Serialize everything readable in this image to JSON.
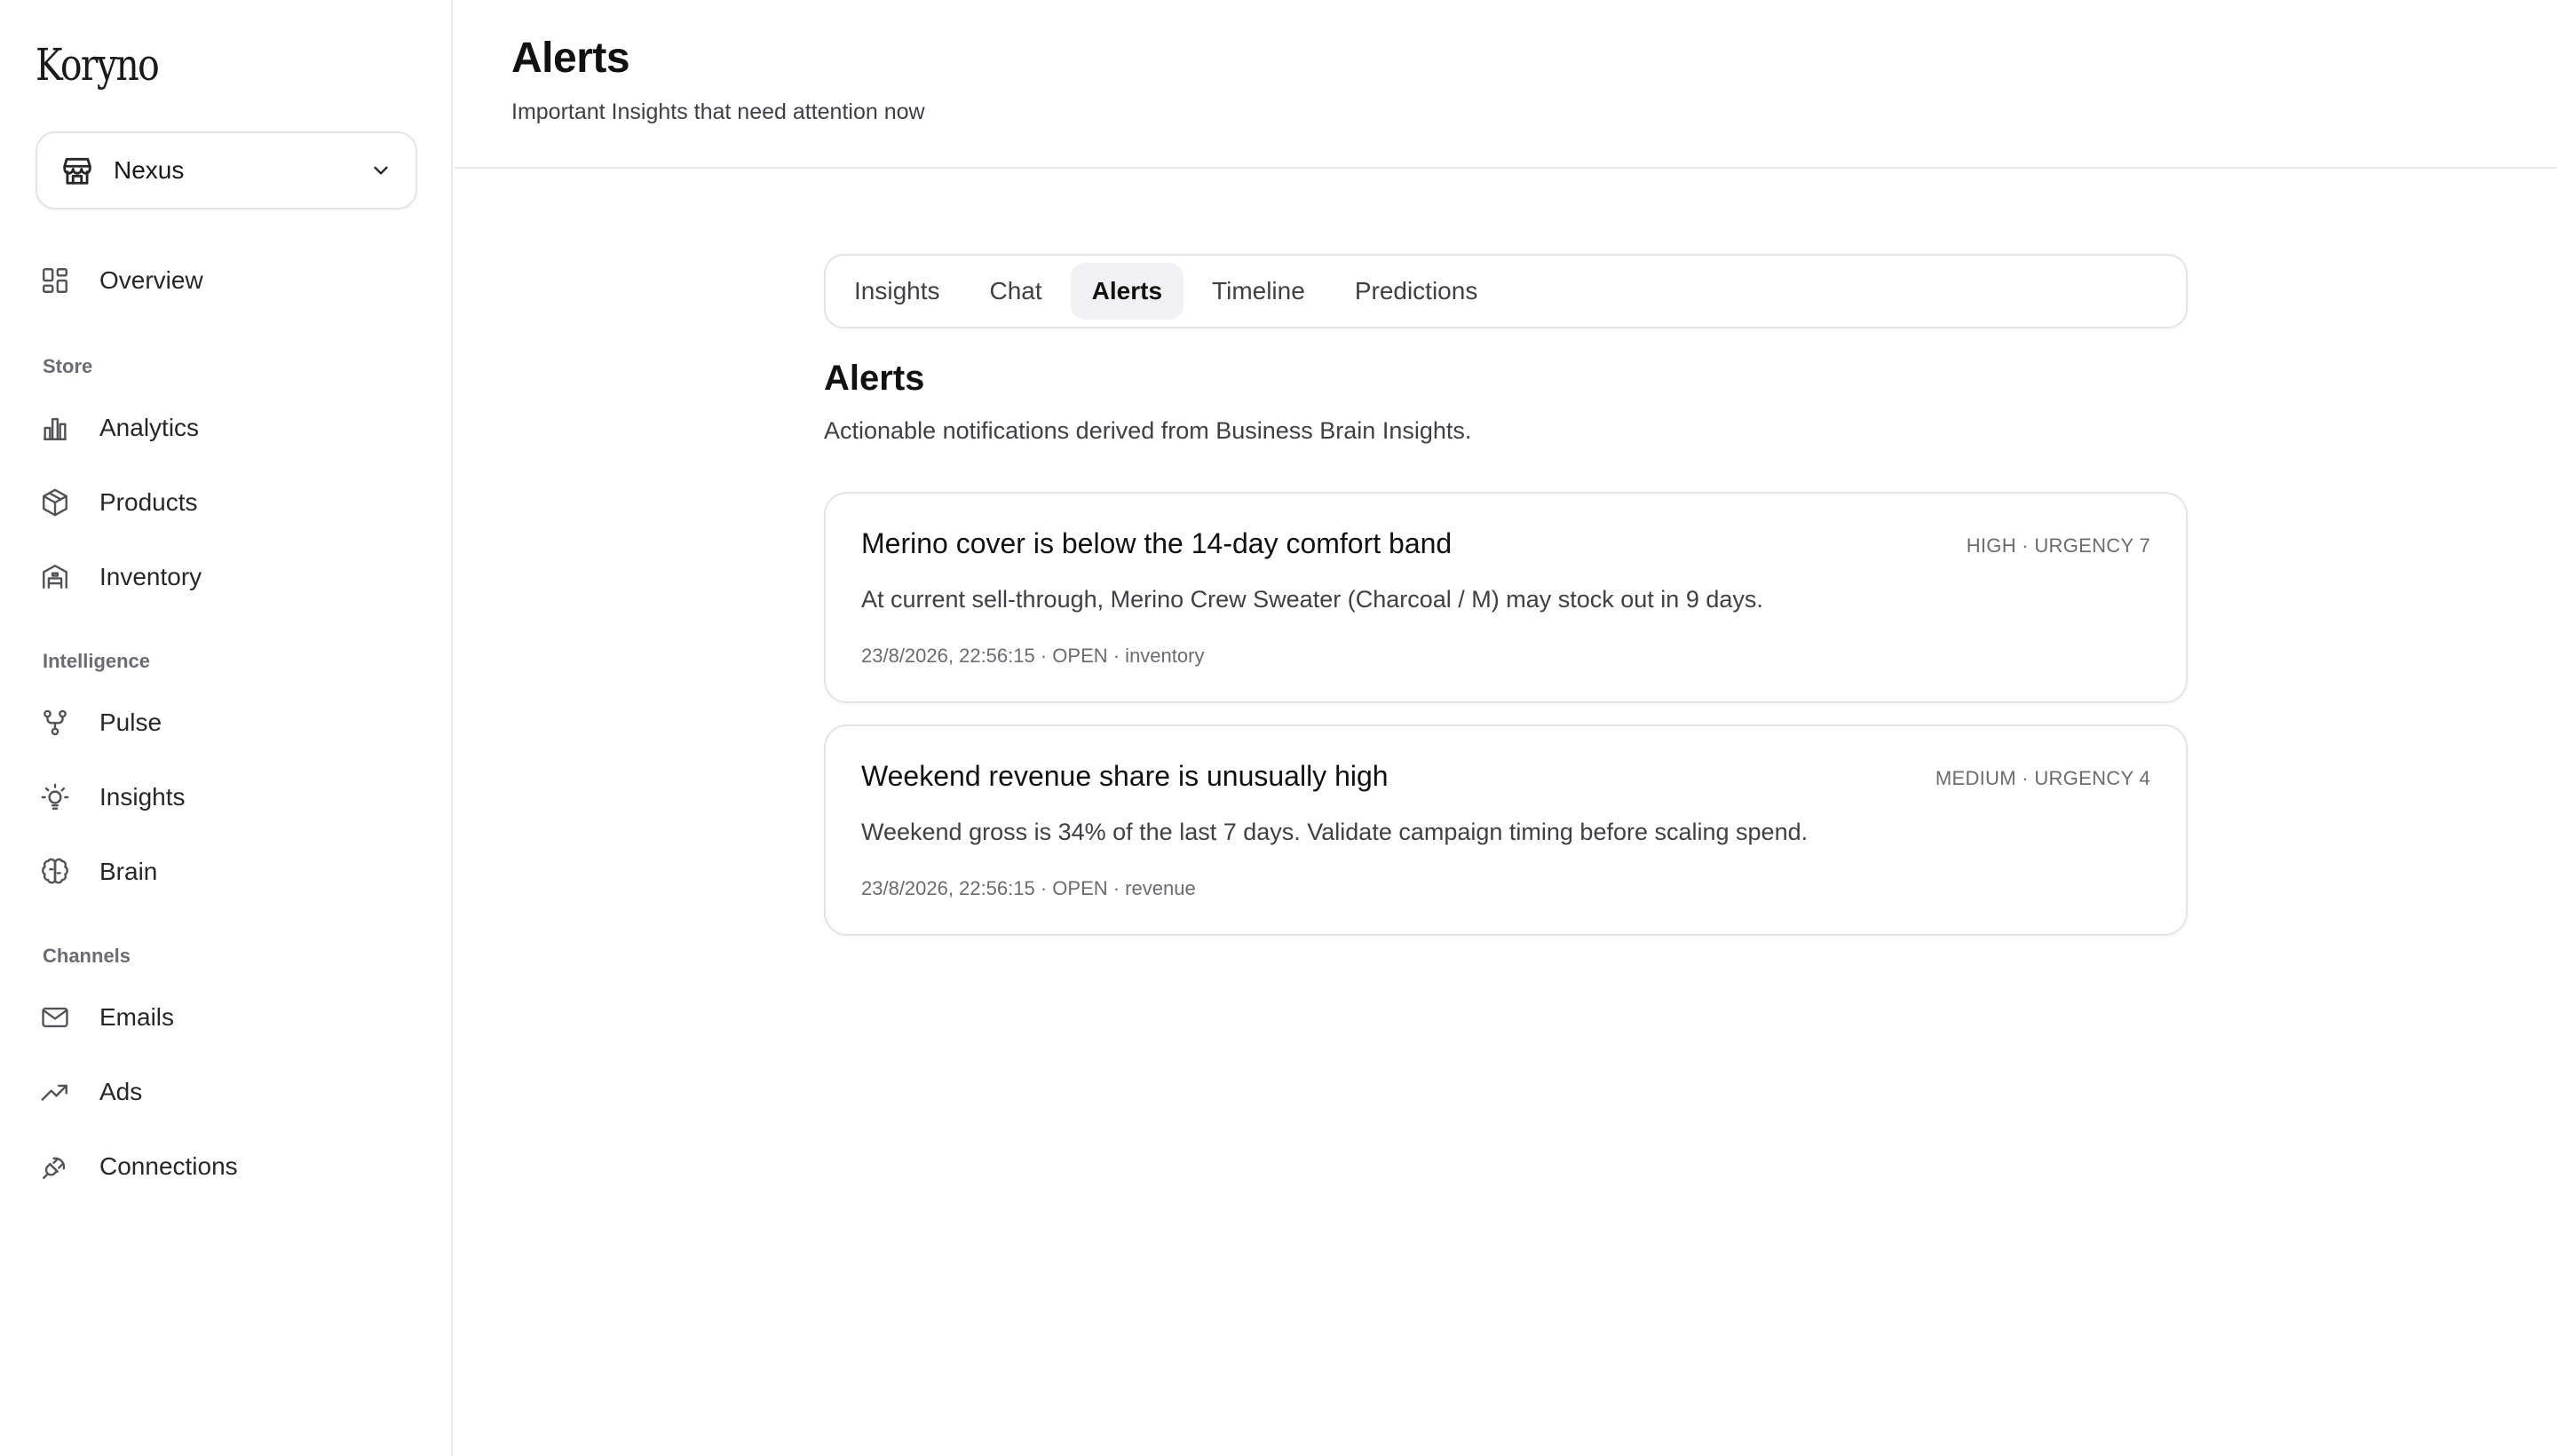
{
  "brand": {
    "logo": "Koryno"
  },
  "store_selector": {
    "name": "Nexus",
    "icon": "store-icon"
  },
  "sidebar": {
    "overview": {
      "label": "Overview",
      "icon": "layout-grid-icon"
    },
    "sections": [
      {
        "label": "Store",
        "items": [
          {
            "label": "Analytics",
            "icon": "bar-chart-icon"
          },
          {
            "label": "Products",
            "icon": "package-icon"
          },
          {
            "label": "Inventory",
            "icon": "warehouse-icon"
          }
        ]
      },
      {
        "label": "Intelligence",
        "items": [
          {
            "label": "Pulse",
            "icon": "git-fork-icon"
          },
          {
            "label": "Insights",
            "icon": "lightbulb-icon"
          },
          {
            "label": "Brain",
            "icon": "brain-icon"
          }
        ]
      },
      {
        "label": "Channels",
        "items": [
          {
            "label": "Emails",
            "icon": "mail-icon"
          },
          {
            "label": "Ads",
            "icon": "trending-up-icon"
          },
          {
            "label": "Connections",
            "icon": "plug-icon"
          }
        ]
      }
    ]
  },
  "header": {
    "title": "Alerts",
    "subtitle": "Important Insights that need attention now"
  },
  "tabs": [
    {
      "label": "Insights",
      "active": false
    },
    {
      "label": "Chat",
      "active": false
    },
    {
      "label": "Alerts",
      "active": true
    },
    {
      "label": "Timeline",
      "active": false
    },
    {
      "label": "Predictions",
      "active": false
    }
  ],
  "alerts_section": {
    "title": "Alerts",
    "description": "Actionable notifications derived from Business Brain Insights."
  },
  "alerts": [
    {
      "title": "Merino cover is below the 14-day comfort band",
      "severity": "HIGH · URGENCY 7",
      "body": "At current sell-through, Merino Crew Sweater (Charcoal / M) may stock out in 9 days.",
      "footer": "23/8/2026, 22:56:15 · OPEN · inventory"
    },
    {
      "title": "Weekend revenue share is unusually high",
      "severity": "MEDIUM · URGENCY 4",
      "body": "Weekend gross is 34% of the last 7 days. Validate campaign timing before scaling spend.",
      "footer": "23/8/2026, 22:56:15 · OPEN · revenue"
    }
  ],
  "colors": {
    "border": "#e4e4e7",
    "active_tab_bg": "#f1f1f4",
    "text_primary": "#111111",
    "text_muted": "#6b6b73"
  }
}
